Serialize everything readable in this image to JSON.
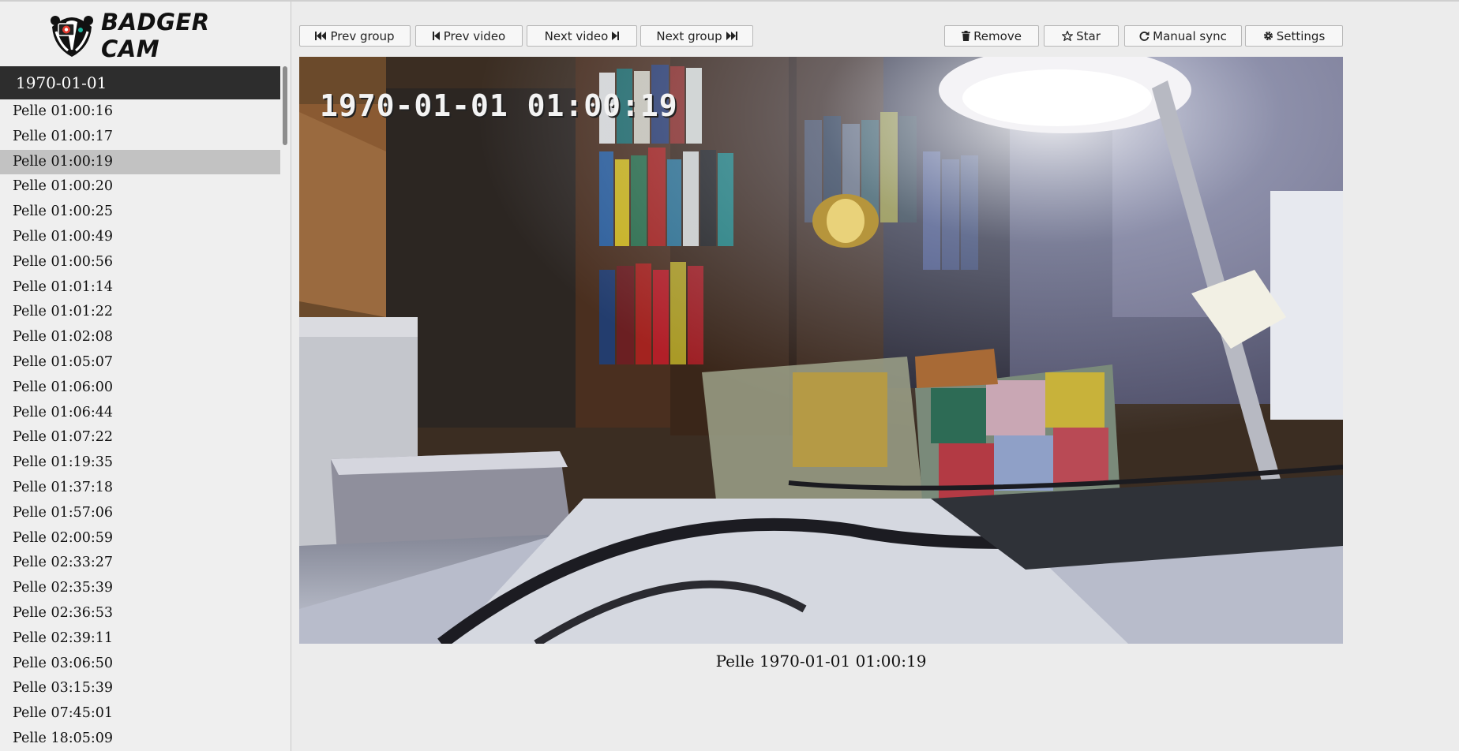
{
  "app": {
    "logo_text": "BADGER CAM"
  },
  "sidebar": {
    "group_label": "1970-01-01",
    "selected_index": 2,
    "items": [
      "Pelle 01:00:16",
      "Pelle 01:00:17",
      "Pelle 01:00:19",
      "Pelle 01:00:20",
      "Pelle 01:00:25",
      "Pelle 01:00:49",
      "Pelle 01:00:56",
      "Pelle 01:01:14",
      "Pelle 01:01:22",
      "Pelle 01:02:08",
      "Pelle 01:05:07",
      "Pelle 01:06:00",
      "Pelle 01:06:44",
      "Pelle 01:07:22",
      "Pelle 01:19:35",
      "Pelle 01:37:18",
      "Pelle 01:57:06",
      "Pelle 02:00:59",
      "Pelle 02:33:27",
      "Pelle 02:35:39",
      "Pelle 02:36:53",
      "Pelle 02:39:11",
      "Pelle 03:06:50",
      "Pelle 03:15:39",
      "Pelle 07:45:01",
      "Pelle 18:05:09"
    ]
  },
  "toolbar": {
    "prev_group": "Prev group",
    "prev_video": "Prev video",
    "next_video": "Next video",
    "next_group": "Next group",
    "remove": "Remove",
    "star": "Star",
    "manual_sync": "Manual sync",
    "settings": "Settings"
  },
  "video": {
    "overlay_timestamp": "1970-01-01 01:00:19",
    "caption": "Pelle 1970-01-01 01:00:19"
  }
}
